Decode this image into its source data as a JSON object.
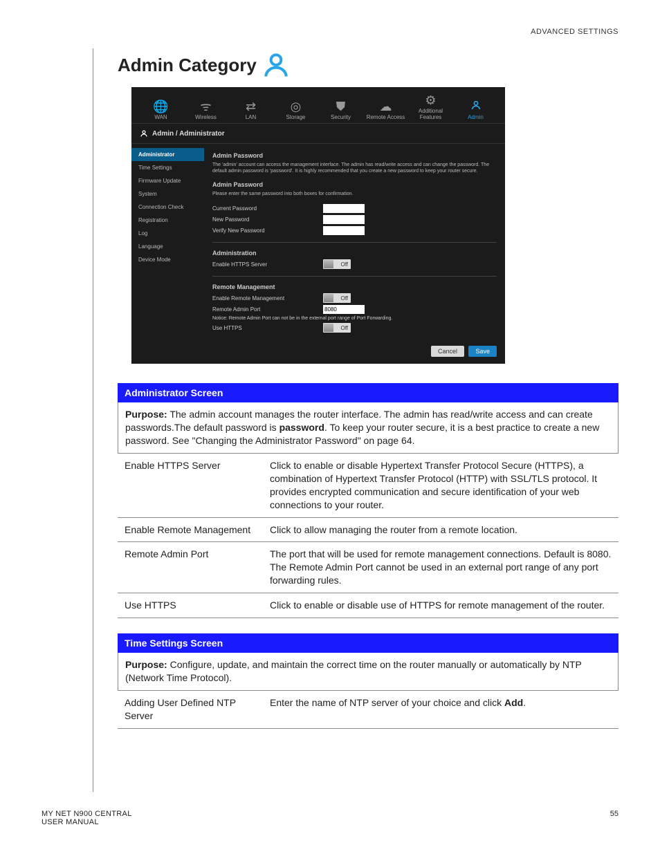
{
  "header": {
    "section": "ADVANCED SETTINGS"
  },
  "title": "Admin Category",
  "router": {
    "tabs": [
      "WAN",
      "Wireless",
      "LAN",
      "Storage",
      "Security",
      "Remote Access",
      "Additional Features",
      "Admin"
    ],
    "active_tab": 7,
    "breadcrumb": "Admin / Administrator",
    "sidenav": [
      "Administrator",
      "Time Settings",
      "Firmware Update",
      "System",
      "Connection Check",
      "Registration",
      "Log",
      "Language",
      "Device Mode"
    ],
    "sidenav_active": 0,
    "panel": {
      "s1_title": "Admin Password",
      "s1_desc": "The 'admin' account can access the management interface. The admin has read/write access and can change the password. The default admin password is 'password'. It is highly recommended that you create a new password to keep your router secure.",
      "s2_title": "Admin Password",
      "s2_hint": "Please enter the same password into both boxes for confirmation.",
      "cur_pw": "Current Password",
      "new_pw": "New Password",
      "ver_pw": "Verify New Password",
      "admin_title": "Administration",
      "https_label": "Enable HTTPS Server",
      "rm_title": "Remote Management",
      "rm_enable": "Enable Remote Management",
      "rm_port_label": "Remote Admin Port",
      "rm_port_value": "8080",
      "rm_notice": "Notice: Remote Admin Port can not be in the external port range of Port Forwarding.",
      "use_https": "Use HTTPS",
      "toggle_off": "Off",
      "cancel": "Cancel",
      "save": "Save"
    }
  },
  "admin_screen": {
    "header": "Administrator Screen",
    "purpose_label": "Purpose:",
    "purpose_text_a": " The admin account manages the router interface. The admin has read/write access and can create passwords.The default password is ",
    "purpose_bold": "password",
    "purpose_text_b": ". To keep your router secure, it is a best practice to create a new password. See \"Changing the Administrator Password\" on page 64.",
    "rows": [
      {
        "k": "Enable HTTPS Server",
        "v": "Click to enable or disable Hypertext Transfer Protocol Secure (HTTPS), a combination of Hypertext Transfer Protocol (HTTP) with SSL/TLS protocol. It provides encrypted communication and secure identification of your web connections to your router."
      },
      {
        "k": "Enable Remote Management",
        "v": "Click to allow managing the router from a remote location."
      },
      {
        "k": "Remote Admin Port",
        "v": "The port that will be used for remote management connections. Default is 8080. The Remote Admin Port cannot be used in an external port range of any port forwarding rules."
      },
      {
        "k": "Use HTTPS",
        "v": "Click to enable or disable use of HTTPS for remote management of the router."
      }
    ]
  },
  "time_screen": {
    "header": "Time Settings Screen",
    "purpose_label": "Purpose:",
    "purpose_text": " Configure, update, and maintain the correct time on the router manually or automatically by NTP (Network Time Protocol).",
    "row_k": "Adding User Defined NTP Server",
    "row_v_a": "Enter the name of NTP server of your choice and click ",
    "row_v_b": "Add",
    "row_v_c": "."
  },
  "footer": {
    "product": "MY NET N900 CENTRAL",
    "manual": "USER MANUAL",
    "page": "55"
  }
}
